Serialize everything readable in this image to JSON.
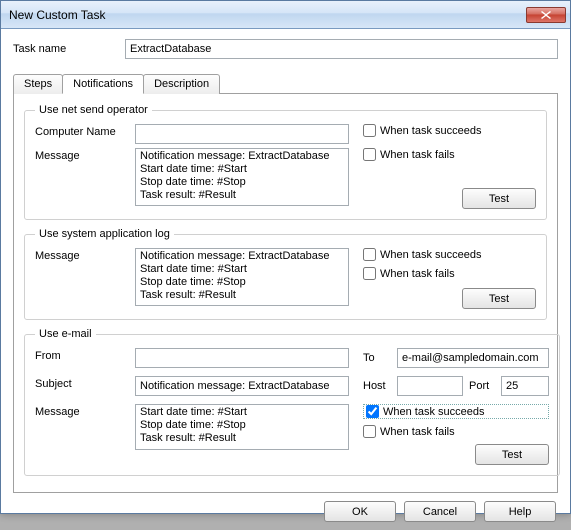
{
  "window": {
    "title": "New Custom Task"
  },
  "taskNameLabel": "Task name",
  "taskName": "ExtractDatabase",
  "tabs": {
    "steps": "Steps",
    "notifications": "Notifications",
    "description": "Description"
  },
  "labels": {
    "computerName": "Computer Name",
    "message": "Message",
    "from": "From",
    "subject": "Subject",
    "to": "To",
    "host": "Host",
    "port": "Port",
    "succeeds": "When task succeeds",
    "fails": "When task fails",
    "test": "Test"
  },
  "groups": {
    "netsend": {
      "legend": "Use net send operator",
      "computerName": "",
      "message": "Notification message: ExtractDatabase\nStart date time: #Start\nStop date time: #Stop\nTask result: #Result",
      "succeeds": false,
      "fails": false
    },
    "syslog": {
      "legend": "Use system application log",
      "message": "Notification message: ExtractDatabase\nStart date time: #Start\nStop date time: #Stop\nTask result: #Result",
      "succeeds": false,
      "fails": false
    },
    "email": {
      "legend": "Use e-mail",
      "from": "",
      "subject": "Notification message: ExtractDatabase",
      "message": "Start date time: #Start\nStop date time: #Stop\nTask result: #Result",
      "to": "e-mail@sampledomain.com",
      "host": "",
      "port": "25",
      "succeeds": true,
      "fails": false
    }
  },
  "buttons": {
    "ok": "OK",
    "cancel": "Cancel",
    "help": "Help"
  }
}
